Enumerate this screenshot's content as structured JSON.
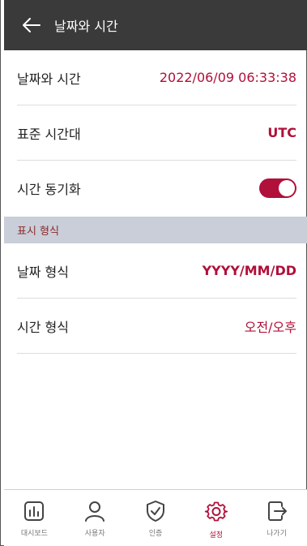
{
  "header": {
    "title": "날짜와 시간"
  },
  "rows": [
    {
      "label": "날짜와 시간",
      "value": "2022/06/09 06:33:38"
    },
    {
      "label": "표준 시간대",
      "value": "UTC"
    },
    {
      "label": "시간 동기화",
      "toggle": true
    }
  ],
  "section": {
    "title": "표시 형식"
  },
  "format_rows": [
    {
      "label": "날짜 형식",
      "value": "YYYY/MM/DD"
    },
    {
      "label": "시간 형식",
      "value": "오전/오후"
    }
  ],
  "nav": [
    {
      "label": "대시보드",
      "icon": "dashboard-icon"
    },
    {
      "label": "사용자",
      "icon": "user-icon"
    },
    {
      "label": "인증",
      "icon": "shield-check-icon"
    },
    {
      "label": "설정",
      "icon": "gear-icon",
      "active": true
    },
    {
      "label": "나가기",
      "icon": "exit-icon"
    }
  ],
  "colors": {
    "accent": "#b0103a",
    "header_bg": "#3a3a3a",
    "section_bg": "#c9ced9"
  }
}
